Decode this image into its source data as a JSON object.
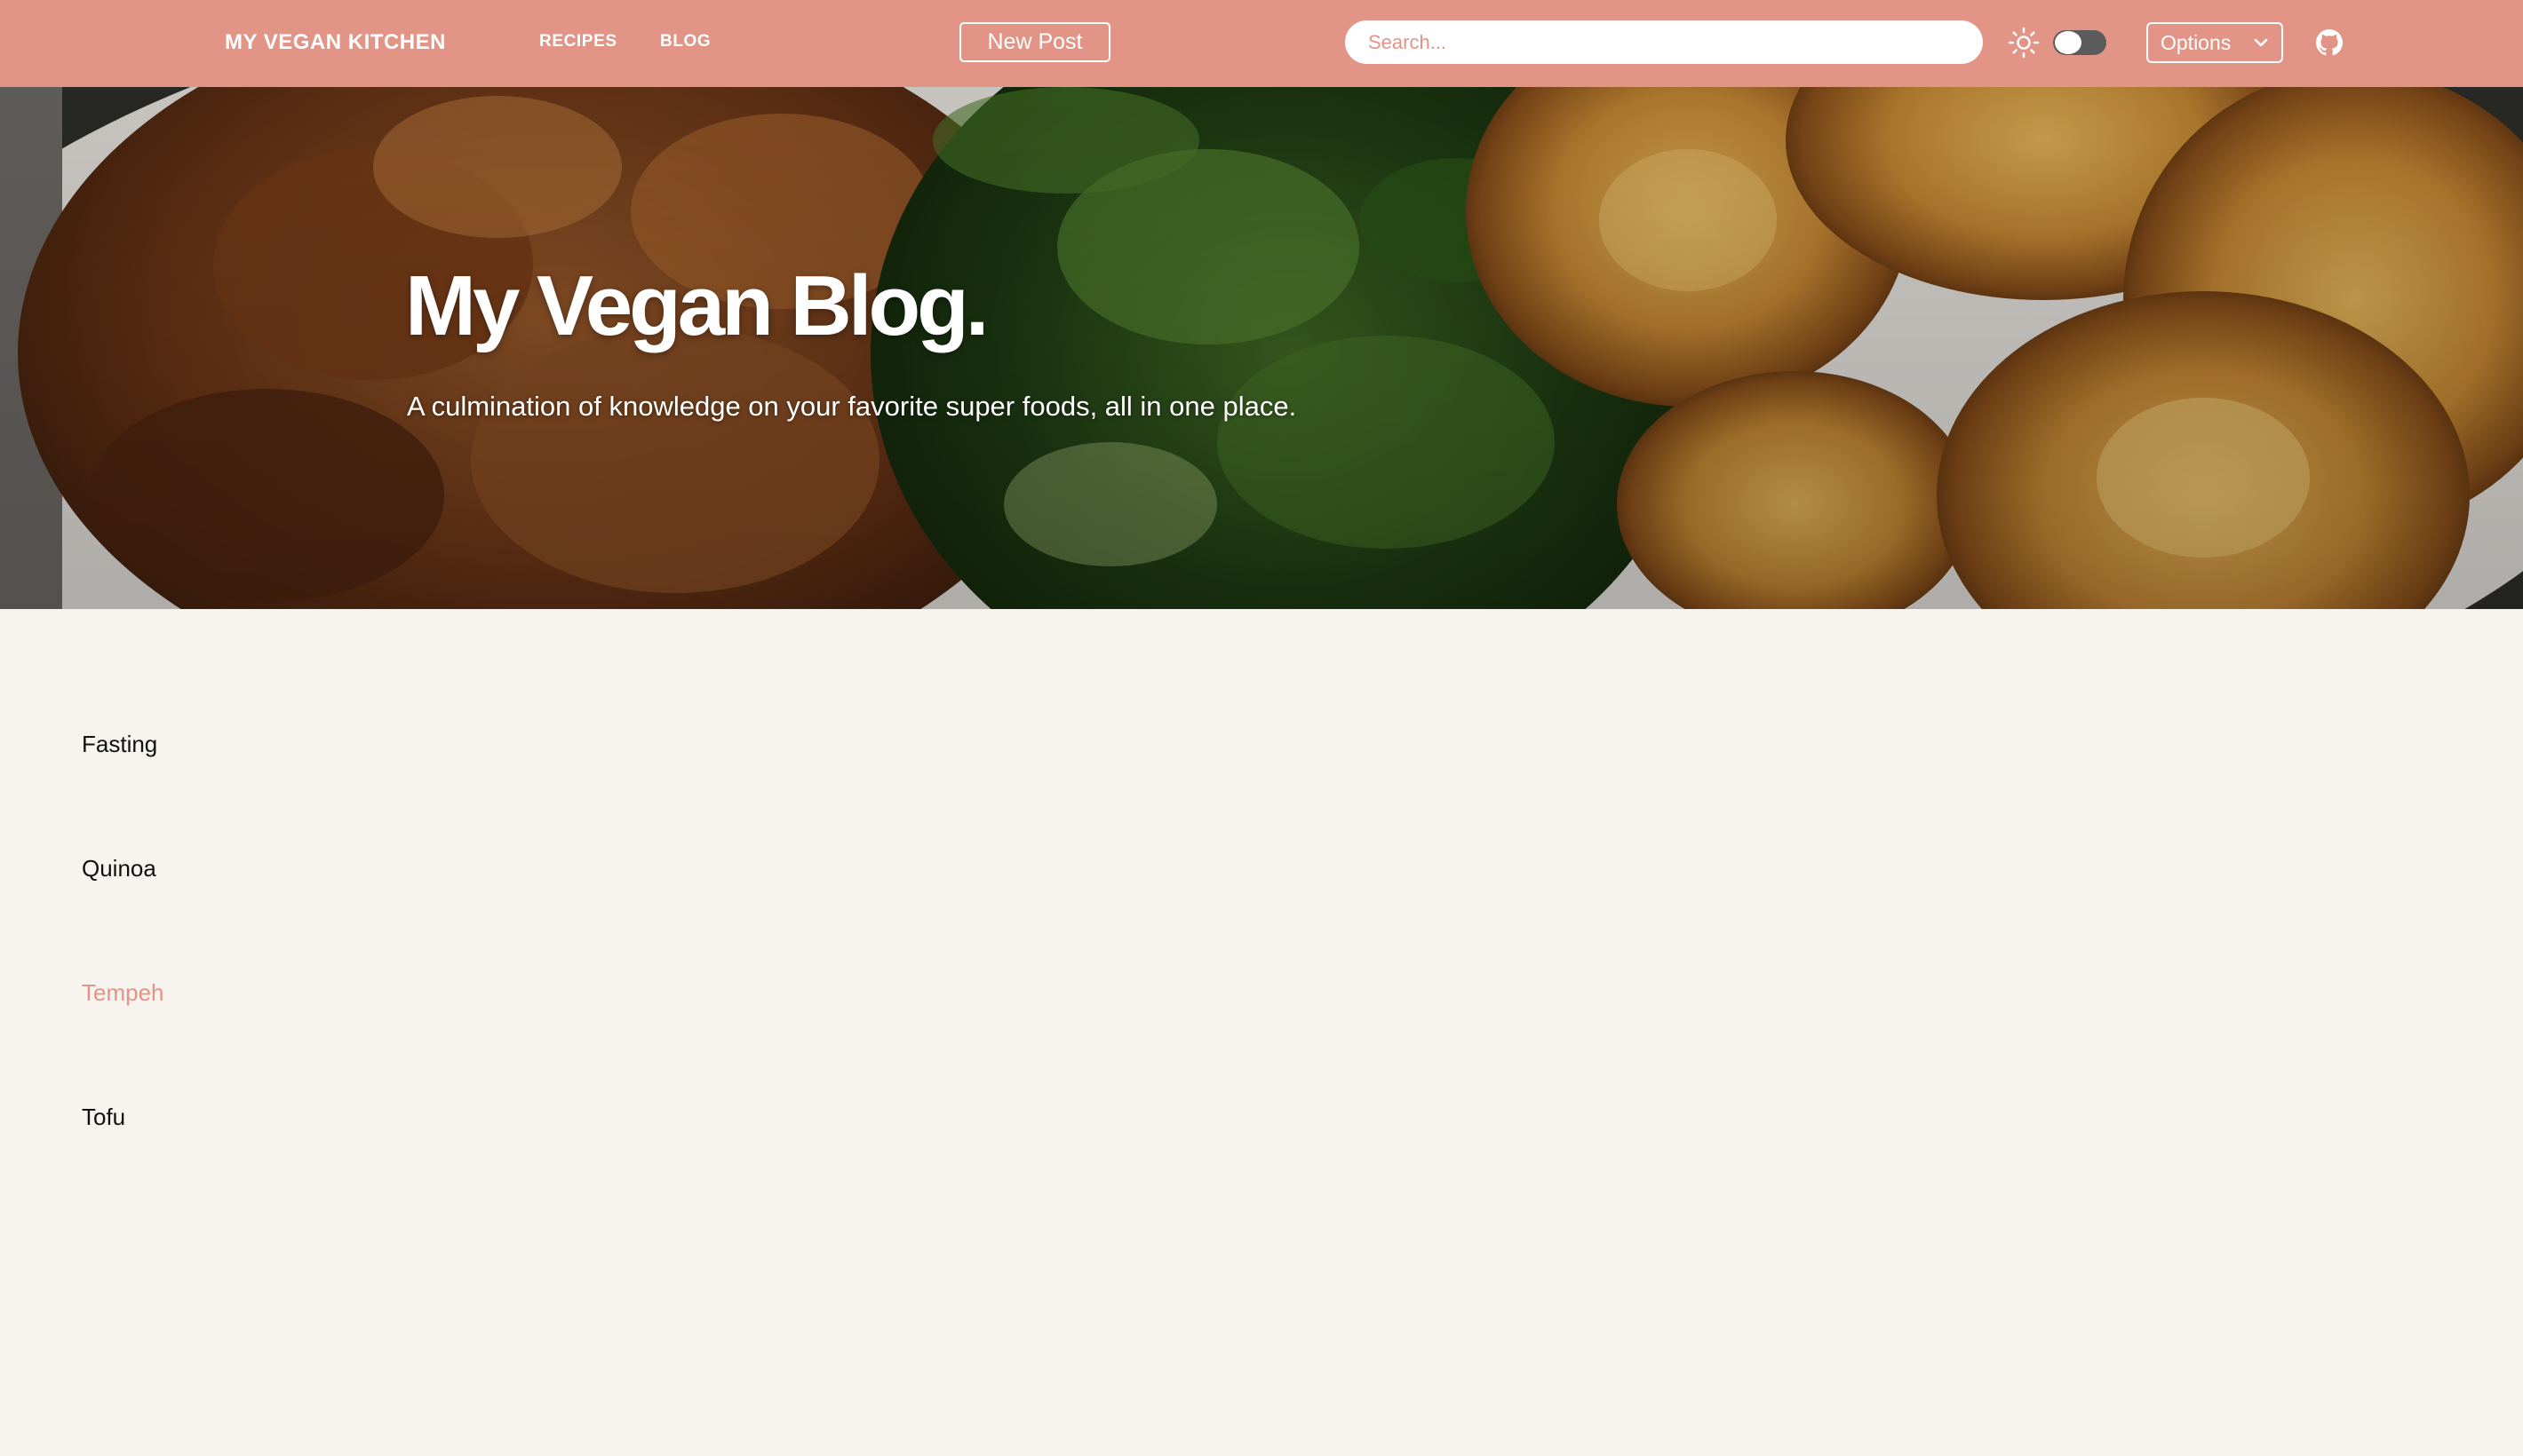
{
  "navbar": {
    "brand": "MY VEGAN KITCHEN",
    "links": [
      "RECIPES",
      "BLOG"
    ],
    "new_post_label": "New Post",
    "search_placeholder": "Search...",
    "theme_toggle_on": false,
    "options_label": "Options",
    "icons": [
      "sun-icon",
      "chevron-down-icon",
      "github-icon"
    ]
  },
  "hero": {
    "title": "My Vegan Blog.",
    "subtitle": "A culmination of knowledge on your favorite super foods, all in one place."
  },
  "categories": {
    "items": [
      "Fasting",
      "Quinoa",
      "Tempeh",
      "Tofu"
    ],
    "active": "Tempeh"
  },
  "colors": {
    "accent": "#e29486",
    "background": "#f7f3ef",
    "text": "#111111"
  }
}
